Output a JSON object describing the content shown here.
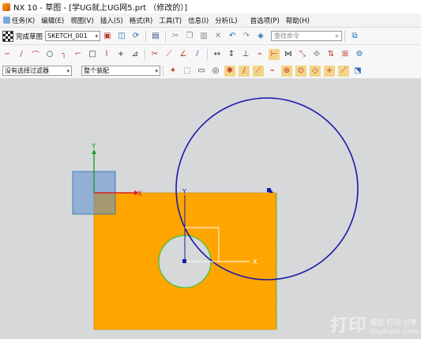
{
  "window": {
    "title": "NX 10 - 草图 - [学UG就上UG网5.prt （修改的）]"
  },
  "menu": {
    "items": [
      {
        "label": "任务(K)"
      },
      {
        "label": "编辑(E)"
      },
      {
        "label": "视图(V)"
      },
      {
        "label": "插入(S)"
      },
      {
        "label": "格式(R)"
      },
      {
        "label": "工具(T)"
      },
      {
        "label": "信息(I)"
      },
      {
        "label": "分析(L)"
      },
      {
        "label": "首选项(P)"
      },
      {
        "label": "帮助(H)"
      }
    ]
  },
  "toolbar": {
    "finish_sketch_label": "完成草图",
    "sketch_name": "SKETCH_001",
    "search_placeholder": "查找命令"
  },
  "filterbar": {
    "selection_filter": "没有选择过滤器",
    "assembly_scope": "整个装配"
  },
  "canvas": {
    "datum_x_label": "X",
    "datum_y_label": "Y",
    "sketch_x_label": "X",
    "sketch_y_label": "Y",
    "colors": {
      "background": "#d6d8da",
      "plate": "#ffa500",
      "big_circle": "#1a1aa8",
      "hole_edge": "#3ec23e",
      "csys_plane": "#5b8fcf"
    }
  },
  "watermark": {
    "logo": "打印",
    "line1": "模型 打印 分享",
    "line2": "dayinpai.com"
  }
}
